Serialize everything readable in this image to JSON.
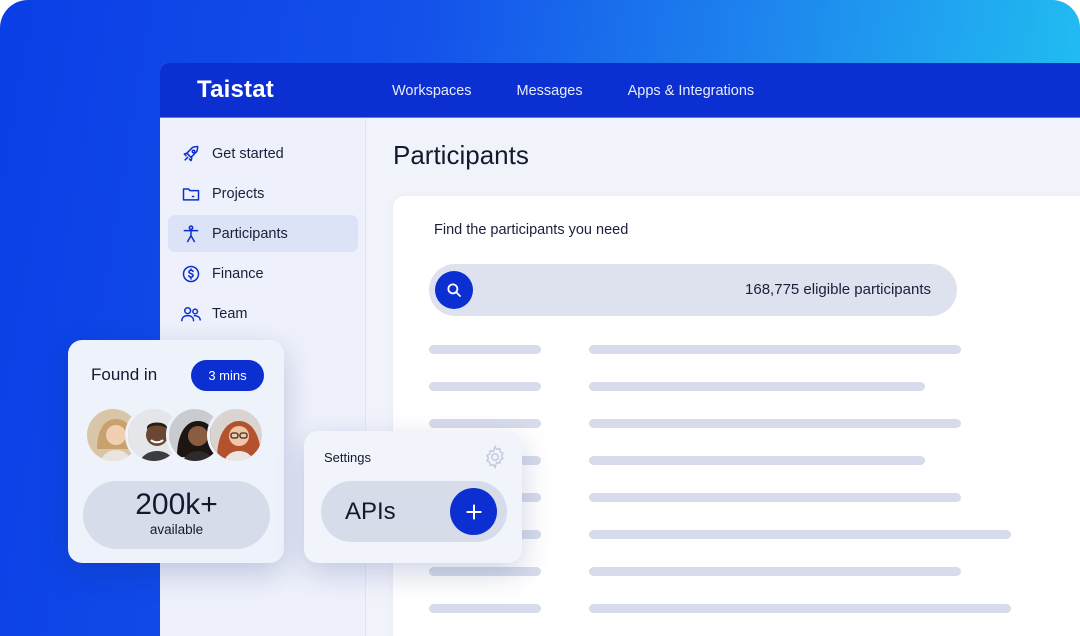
{
  "app": {
    "brand": "Taistat"
  },
  "topnav": {
    "items": [
      {
        "label": "Workspaces"
      },
      {
        "label": "Messages"
      },
      {
        "label": "Apps & Integrations"
      }
    ]
  },
  "sidebar": {
    "items": [
      {
        "label": "Get started",
        "icon": "rocket-icon"
      },
      {
        "label": "Projects",
        "icon": "folder-icon"
      },
      {
        "label": "Participants",
        "icon": "person-icon",
        "active": true
      },
      {
        "label": "Finance",
        "icon": "dollar-icon"
      },
      {
        "label": "Team",
        "icon": "team-icon"
      }
    ]
  },
  "main": {
    "title": "Participants",
    "find_label": "Find the participants you need",
    "search": {
      "count_text": "168,775 eligible participants"
    }
  },
  "found_card": {
    "label": "Found in",
    "time_badge": "3 mins",
    "count": "200k+",
    "count_caption": "available"
  },
  "settings_card": {
    "label": "Settings",
    "item_label": "APIs"
  },
  "colors": {
    "accent": "#0b2fd0",
    "background_gradient_start": "#0a3ee6",
    "background_gradient_end": "#22cdf2",
    "skeleton": "#d7dcec"
  }
}
